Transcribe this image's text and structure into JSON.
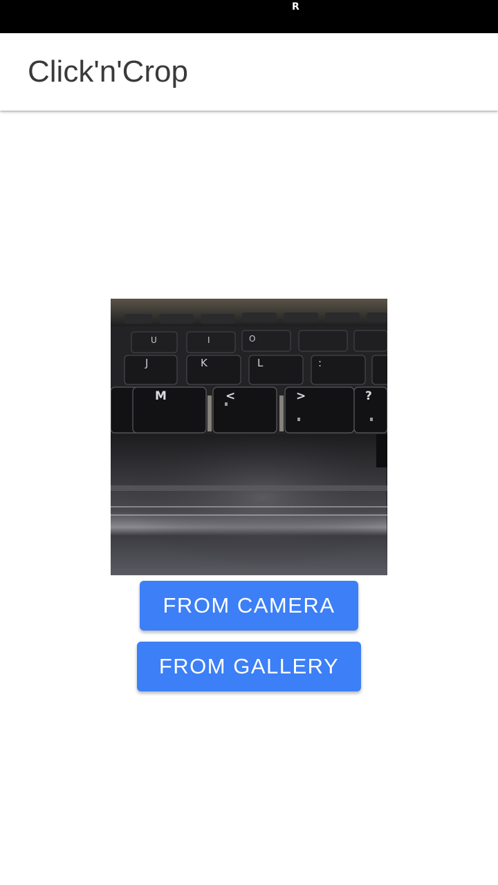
{
  "status_bar": {
    "indicator": "R"
  },
  "app_bar": {
    "title": "Click'n'Crop"
  },
  "preview": {
    "keys": [
      "U",
      "I",
      "O",
      "J",
      "K",
      "L",
      ":",
      "M",
      "<",
      ">",
      "?"
    ]
  },
  "actions": {
    "camera_label": "FROM CAMERA",
    "gallery_label": "FROM GALLERY"
  },
  "colors": {
    "status_bar": "#000000",
    "app_bar": "#ffffff",
    "button": "#3c7ff6",
    "button_text": "#ffffff",
    "title_text": "#3a3a3a"
  }
}
